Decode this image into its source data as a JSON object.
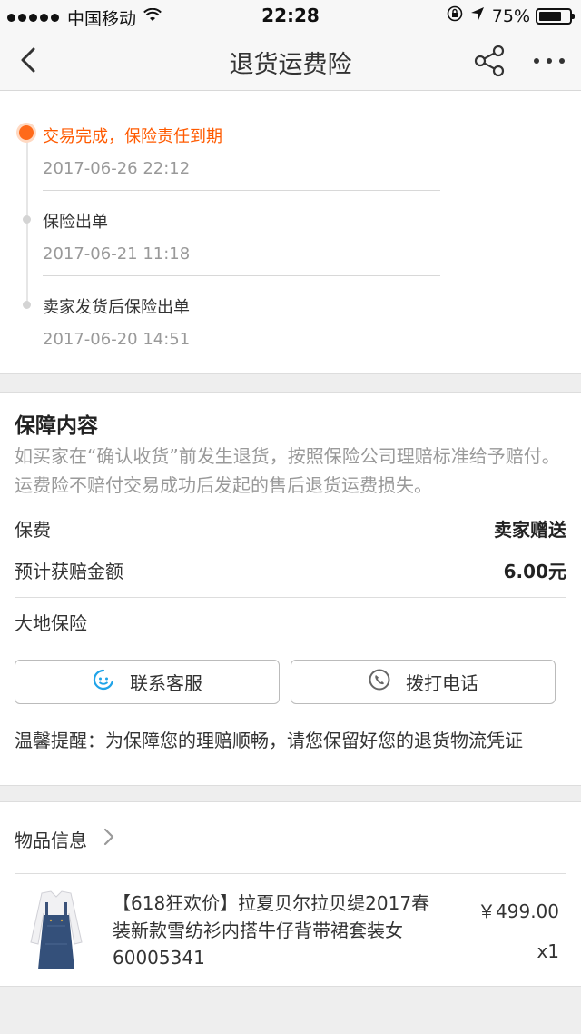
{
  "status_bar": {
    "carrier": "中国移动",
    "time": "22:28",
    "battery": "75%",
    "battery_level": 0.75
  },
  "nav": {
    "title": "退货运费险",
    "icons": [
      "back-chevron-icon",
      "share-icon",
      "more-icon"
    ]
  },
  "timeline": [
    {
      "title": "交易完成，保险责任到期",
      "time": "2017-06-26 22:12"
    },
    {
      "title": "保险出单",
      "time": "2017-06-21 11:18"
    },
    {
      "title": "卖家发货后保险出单",
      "time": "2017-06-20 14:51"
    }
  ],
  "guarantee": {
    "title": "保障内容",
    "description": "如买家在“确认收货”前发生退货，按照保险公司理赔标准给予赔付。运费险不赔付交易成功后发起的售后退货运费损失。",
    "premium_label": "保费",
    "premium_value": "卖家赠送",
    "claim_label": "预计获赔金额",
    "claim_value": "6.00元",
    "company": "大地保险",
    "contact_button": "联系客服",
    "call_button": "拨打电话",
    "tip": "温馨提醒：为保障您的理赔顺畅，请您保留好您的退货物流凭证"
  },
  "items": {
    "header": "物品信息",
    "product": {
      "title": "【618狂欢价】拉夏贝尔拉贝缇2017春装新款雪纺衫内搭牛仔背带裙套装女60005341",
      "price": "￥499.00",
      "quantity": "x1"
    }
  },
  "colors": {
    "accent": "#ff5a00",
    "muted": "#999999",
    "background": "#eeeeee"
  }
}
